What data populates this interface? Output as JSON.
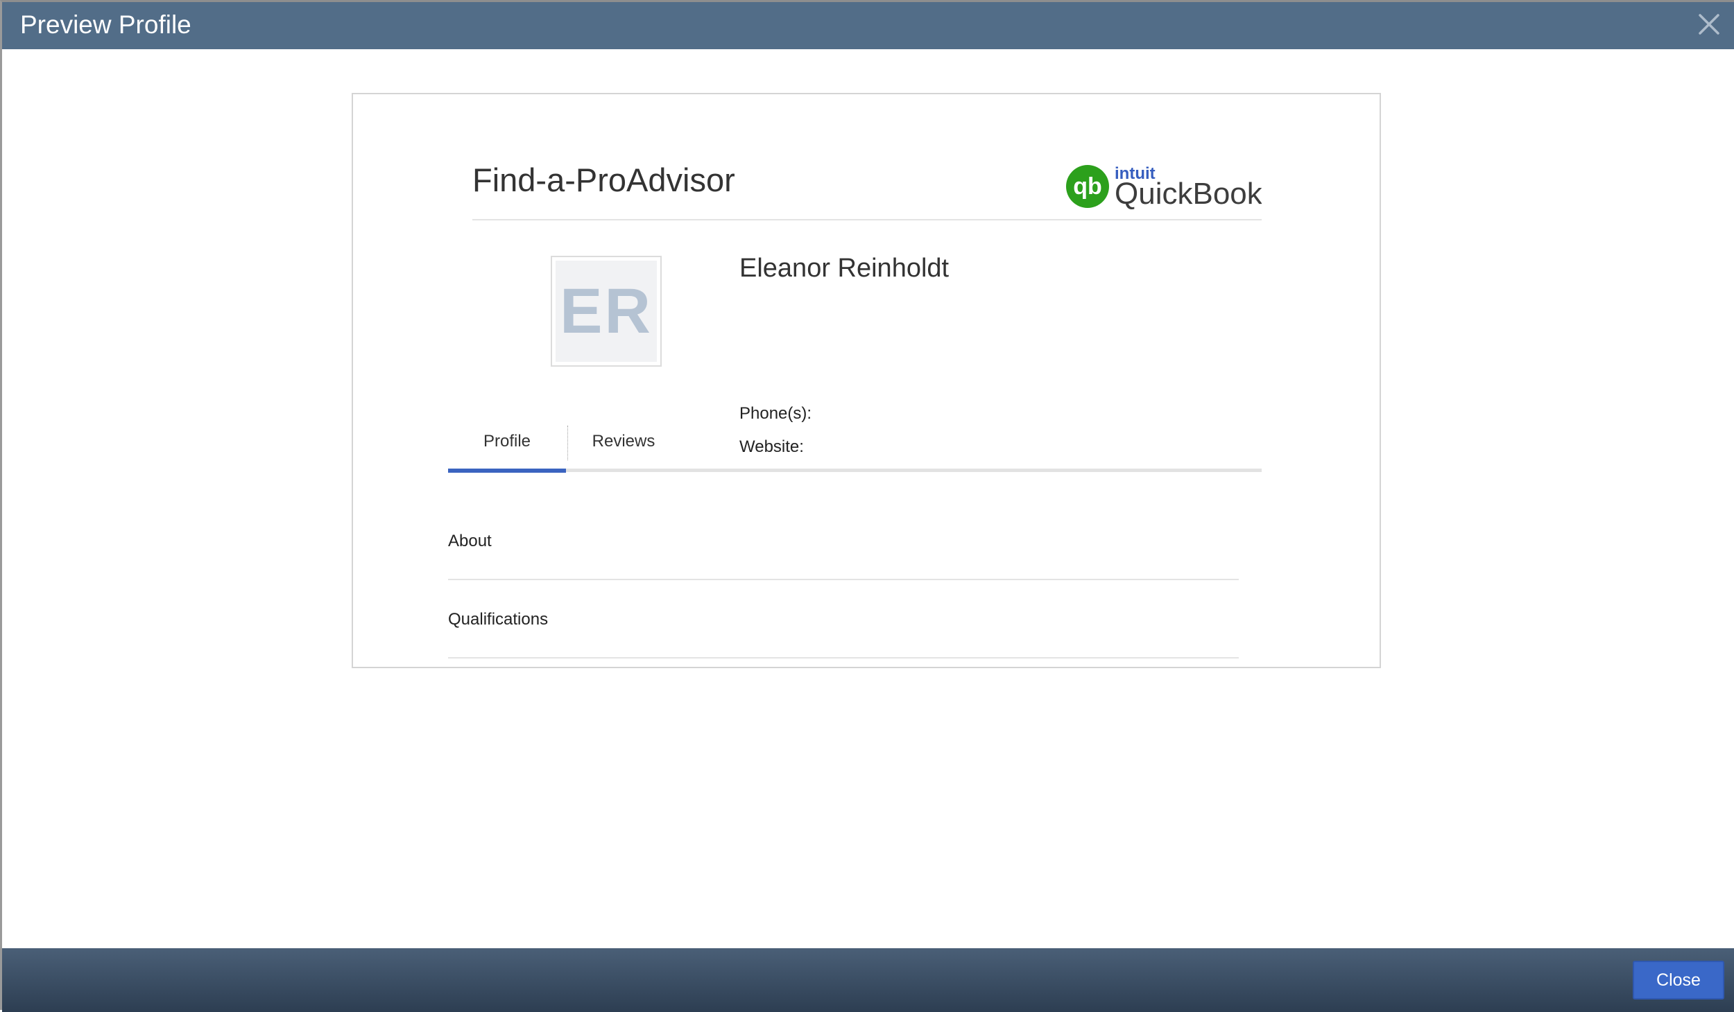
{
  "dialog": {
    "title": "Preview Profile",
    "close_icon": "close-icon"
  },
  "card": {
    "heading": "Find-a-ProAdvisor",
    "logo": {
      "brand_small": "intuit",
      "brand_large": "QuickBooks",
      "mark_text": "qb",
      "brand_color": "#2ca01c",
      "intuit_color": "#365ebf"
    }
  },
  "profile": {
    "initials": "ER",
    "name": "Eleanor Reinholdt",
    "phone_label": "Phone(s):",
    "website_label": "Website:"
  },
  "tabs": [
    {
      "label": "Profile",
      "active": true
    },
    {
      "label": "Reviews",
      "active": false
    }
  ],
  "sections": [
    {
      "label": "About"
    },
    {
      "label": "Qualifications"
    }
  ],
  "footer": {
    "close_label": "Close"
  },
  "colors": {
    "titlebar": "#526d88",
    "active_tab": "#3b64c0",
    "primary_button": "#3a68c8"
  }
}
